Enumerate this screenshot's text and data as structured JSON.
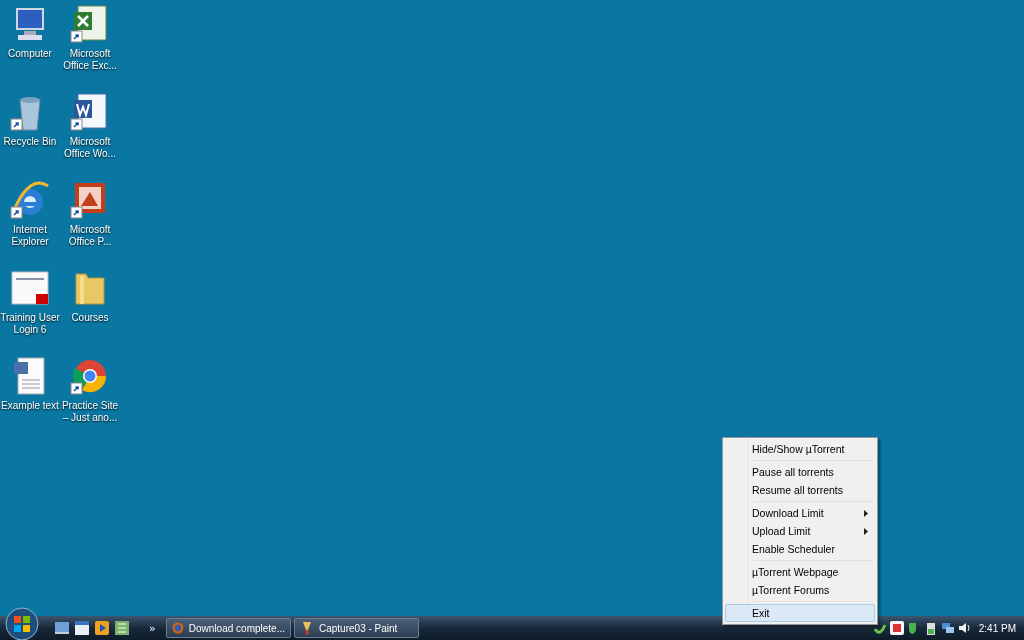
{
  "desktop_icons": [
    {
      "label": "Computer",
      "kind": "computer",
      "shortcut": false
    },
    {
      "label": "Microsoft Office Exc...",
      "kind": "excel",
      "shortcut": true
    },
    {
      "label": "Recycle Bin",
      "kind": "recycle",
      "shortcut": true
    },
    {
      "label": "Microsoft Office Wo...",
      "kind": "word",
      "shortcut": true
    },
    {
      "label": "Internet Explorer",
      "kind": "ie",
      "shortcut": true
    },
    {
      "label": "Microsoft Office P...",
      "kind": "powerpoint",
      "shortcut": true
    },
    {
      "label": "Training User Login 6",
      "kind": "pdf",
      "shortcut": false
    },
    {
      "label": "Courses",
      "kind": "folder",
      "shortcut": false
    },
    {
      "label": "Example text",
      "kind": "document",
      "shortcut": false
    },
    {
      "label": "Practice Site – Just ano...",
      "kind": "chrome",
      "shortcut": true
    }
  ],
  "context_menu": {
    "groups": [
      [
        {
          "label": "Hide/Show µTorrent",
          "submenu": false,
          "selected": false
        }
      ],
      [
        {
          "label": "Pause all torrents",
          "submenu": false,
          "selected": false
        },
        {
          "label": "Resume all torrents",
          "submenu": false,
          "selected": false
        }
      ],
      [
        {
          "label": "Download Limit",
          "submenu": true,
          "selected": false
        },
        {
          "label": "Upload Limit",
          "submenu": true,
          "selected": false
        },
        {
          "label": "Enable Scheduler",
          "submenu": false,
          "selected": false
        }
      ],
      [
        {
          "label": "µTorrent Webpage",
          "submenu": false,
          "selected": false
        },
        {
          "label": "µTorrent Forums",
          "submenu": false,
          "selected": false
        }
      ],
      [
        {
          "label": "Exit",
          "submenu": false,
          "selected": true
        }
      ]
    ]
  },
  "taskbar": {
    "overflow": "»",
    "tasks": [
      {
        "label": "Download complete...",
        "kind": "firefox"
      },
      {
        "label": "Capture03 - Paint",
        "kind": "paint"
      }
    ],
    "clock": "2:41 PM"
  }
}
